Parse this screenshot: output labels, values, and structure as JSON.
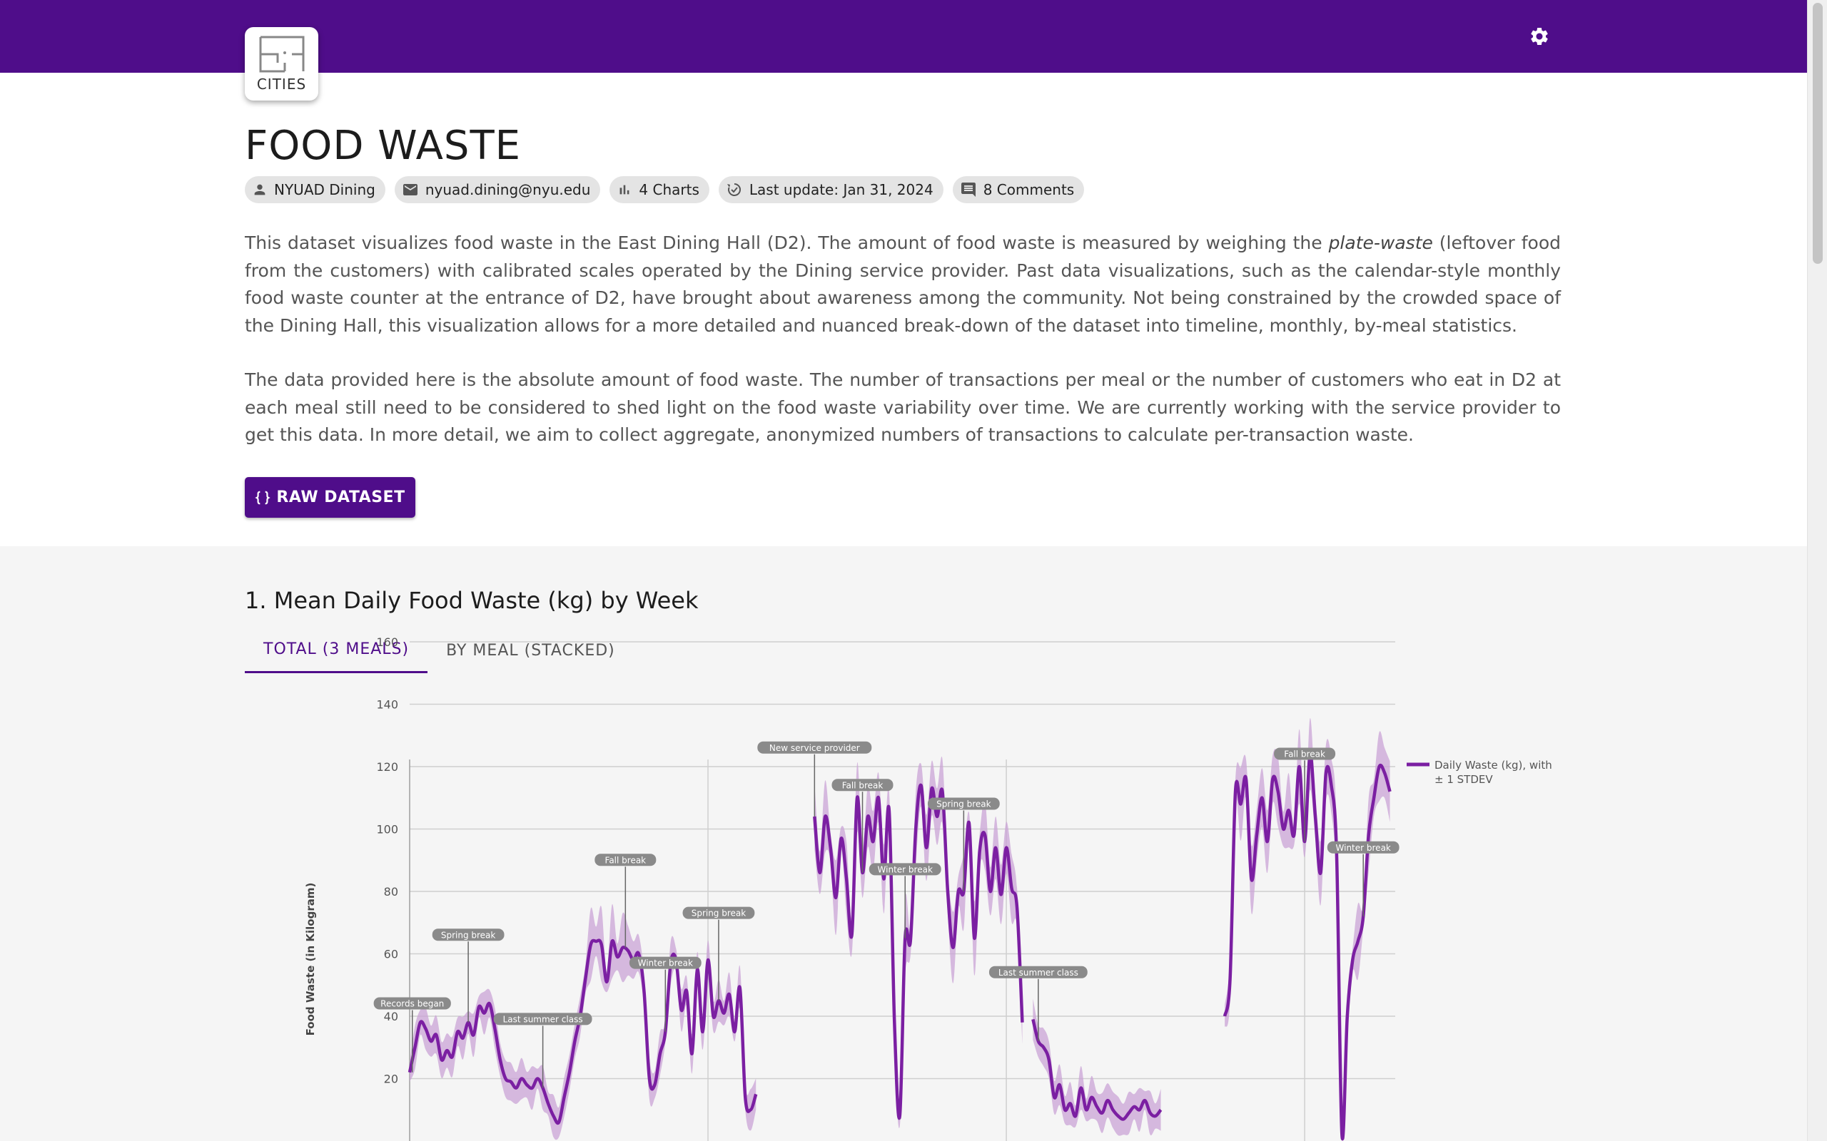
{
  "header": {
    "logo_text": "CITIES",
    "settings_icon": "gear-icon",
    "bar_color": "#4f0d8a"
  },
  "page": {
    "title": "FOOD WASTE",
    "chips": [
      {
        "icon": "person-icon",
        "label": "NYUAD Dining"
      },
      {
        "icon": "email-icon",
        "label": "nyuad.dining@nyu.edu"
      },
      {
        "icon": "bar-chart-icon",
        "label": "4 Charts"
      },
      {
        "icon": "update-icon",
        "label": "Last update: Jan 31, 2024"
      },
      {
        "icon": "comment-icon",
        "label": "8 Comments"
      }
    ],
    "description_p1": {
      "before": "This dataset visualizes food waste in the East Dining Hall (D2). The amount of food waste is measured by weighing the ",
      "emphasis": "plate-waste",
      "after": " (leftover food from the customers) with calibrated scales operated by the Dining service provider. Past data visualizations, such as the calendar-style monthly food waste counter at the entrance of D2, have brought about awareness among the community. Not being constrained by the crowded space of the Dining Hall, this visualization allows for a more detailed and nuanced break-down of the dataset into timeline, monthly, by-meal statistics."
    },
    "description_p2": "The data provided here is the absolute amount of food waste. The number of transactions per meal or the number of customers who eat in D2 at each meal still need to be considered to shed light on the food waste variability over time. We are currently working with the service provider to get this data. In more detail, we aim to collect aggregate, anonymized numbers of transactions to calculate per-transaction waste.",
    "raw_button": "RAW DATASET"
  },
  "section": {
    "title": "1. Mean Daily Food Waste (kg) by Week",
    "tabs": [
      {
        "label": "TOTAL (3 MEALS)",
        "active": true
      },
      {
        "label": "BY MEAL (STACKED)",
        "active": false
      }
    ]
  },
  "chart_data": {
    "type": "line",
    "ylabel": "Food Waste (in Kilogram)",
    "ylim": [
      0,
      160
    ],
    "yticks": [
      20,
      40,
      60,
      80,
      100,
      120,
      140,
      160
    ],
    "grid": true,
    "legend": {
      "position": "top-right",
      "label_line1": "Daily Waste (kg), with",
      "label_line2": "± 1 STDEV"
    },
    "line_color": "#7b1fa2",
    "band_color": "#c9a3d6",
    "series": [
      {
        "x": [
          0,
          2,
          4,
          6,
          8,
          10,
          12,
          14,
          16,
          18,
          20,
          22,
          24,
          26,
          28,
          30,
          32,
          34,
          36,
          38,
          40,
          42,
          44,
          46,
          48,
          50,
          52,
          54,
          56,
          58,
          60,
          62,
          64,
          66,
          68,
          70,
          72,
          74,
          76,
          78,
          80,
          82,
          84,
          86,
          88,
          90,
          92,
          94,
          96,
          98,
          100,
          102,
          104,
          106,
          108,
          110,
          112,
          114,
          116,
          118,
          120,
          122,
          124,
          126,
          128,
          130
        ],
        "y": [
          22,
          30,
          38,
          36,
          32,
          34,
          26,
          29,
          27,
          35,
          33,
          38,
          34,
          43,
          41,
          44,
          36,
          26,
          20,
          19,
          17,
          20,
          18,
          17,
          20,
          17,
          12,
          8,
          6,
          14,
          22,
          32,
          40,
          52,
          63,
          64,
          63,
          51,
          64,
          59,
          62,
          61,
          58,
          60,
          48,
          20,
          18,
          28,
          35,
          57,
          58,
          42,
          48,
          28,
          55,
          35,
          58,
          40,
          45,
          41,
          47,
          35,
          49,
          14,
          10,
          15
        ]
      },
      {
        "x": [
          152,
          154,
          156,
          158,
          160,
          162,
          164,
          166,
          168,
          170,
          172,
          174,
          176,
          178,
          180,
          182,
          184,
          186,
          188,
          190,
          192,
          194,
          196,
          198,
          200,
          202,
          204,
          206,
          208,
          210,
          212,
          214,
          216,
          218,
          220,
          222,
          224,
          226,
          228,
          230
        ],
        "y": [
          104,
          86,
          104,
          94,
          78,
          97,
          84,
          66,
          110,
          86,
          104,
          96,
          110,
          84,
          106,
          38,
          8,
          65,
          64,
          100,
          114,
          94,
          113,
          104,
          112,
          80,
          62,
          80,
          80,
          102,
          65,
          93,
          98,
          80,
          94,
          79,
          94,
          81,
          75,
          38
        ]
      },
      {
        "x": [
          234,
          236,
          238,
          240,
          242,
          244,
          246,
          248,
          250,
          252,
          254,
          256,
          258,
          260,
          262,
          264,
          266,
          268,
          270,
          272,
          274,
          276,
          278,
          280,
          282
        ],
        "y": [
          39,
          32,
          30,
          26,
          14,
          18,
          10,
          12,
          8,
          17,
          10,
          14,
          11,
          9,
          13,
          10,
          8,
          7,
          9,
          11,
          10,
          13,
          9,
          8,
          10
        ]
      },
      {
        "x": [
          306,
          308,
          310,
          312,
          314,
          316,
          318,
          320,
          322,
          324,
          326,
          328,
          330,
          332,
          334,
          336,
          338,
          340,
          342,
          344,
          346,
          348,
          350,
          352,
          354,
          356,
          358,
          360,
          362,
          364,
          366,
          368
        ],
        "y": [
          40,
          52,
          112,
          108,
          116,
          84,
          98,
          110,
          96,
          116,
          112,
          100,
          106,
          98,
          120,
          96,
          124,
          104,
          86,
          118,
          114,
          92,
          2,
          40,
          58,
          64,
          72,
          98,
          110,
          120,
          118,
          112
        ]
      }
    ],
    "annotations": [
      {
        "label": "Records began",
        "x": 1
      },
      {
        "label": "Spring break",
        "x": 22
      },
      {
        "label": "Last summer class",
        "x": 50
      },
      {
        "label": "Fall break",
        "x": 81
      },
      {
        "label": "Winter break",
        "x": 96
      },
      {
        "label": "Spring break",
        "x": 116
      },
      {
        "label": "New service provider",
        "x": 152
      },
      {
        "label": "Fall break",
        "x": 170
      },
      {
        "label": "Winter break",
        "x": 186
      },
      {
        "label": "Spring break",
        "x": 208
      },
      {
        "label": "Last summer class",
        "x": 236
      },
      {
        "label": "Fall break",
        "x": 336
      },
      {
        "label": "Winter break",
        "x": 358
      }
    ]
  }
}
